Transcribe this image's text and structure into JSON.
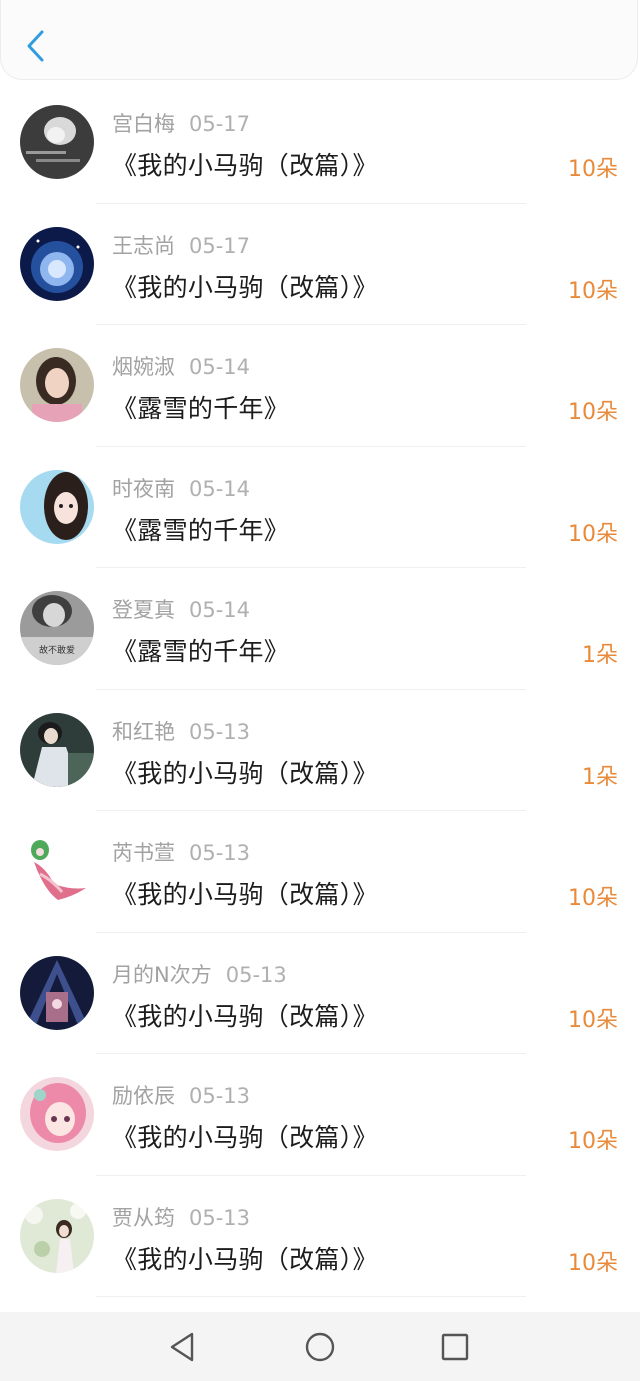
{
  "header": {
    "back_icon": "chevron-left-icon",
    "accent": "#2f9be0"
  },
  "feed": [
    {
      "name": "宫白梅",
      "date": "05-17",
      "title": "《我的小马驹（改篇）》",
      "flowers": "10朵"
    },
    {
      "name": "王志尚",
      "date": "05-17",
      "title": "《我的小马驹（改篇）》",
      "flowers": "10朵"
    },
    {
      "name": "烟婉淑",
      "date": "05-14",
      "title": "《露雪的千年》",
      "flowers": "10朵"
    },
    {
      "name": "时夜南",
      "date": "05-14",
      "title": "《露雪的千年》",
      "flowers": "10朵"
    },
    {
      "name": "登夏真",
      "date": "05-14",
      "title": "《露雪的千年》",
      "flowers": "1朵"
    },
    {
      "name": "和红艳",
      "date": "05-13",
      "title": "《我的小马驹（改篇）》",
      "flowers": "1朵"
    },
    {
      "name": "芮书萱",
      "date": "05-13",
      "title": "《我的小马驹（改篇）》",
      "flowers": "10朵"
    },
    {
      "name": "月的N次方",
      "date": "05-13",
      "title": "《我的小马驹（改篇）》",
      "flowers": "10朵"
    },
    {
      "name": "励依辰",
      "date": "05-13",
      "title": "《我的小马驹（改篇）》",
      "flowers": "10朵"
    },
    {
      "name": "贾从筠",
      "date": "05-13",
      "title": "《我的小马驹（改篇）》",
      "flowers": "10朵"
    }
  ],
  "avatar_text": {
    "row5": "故不敢爱"
  },
  "colors": {
    "flowers": "#e98a3a",
    "meta": "#a2a2a2",
    "title": "#1c1c1c"
  },
  "system_nav": {
    "back": "triangle-back-icon",
    "home": "circle-home-icon",
    "recents": "square-recents-icon"
  }
}
